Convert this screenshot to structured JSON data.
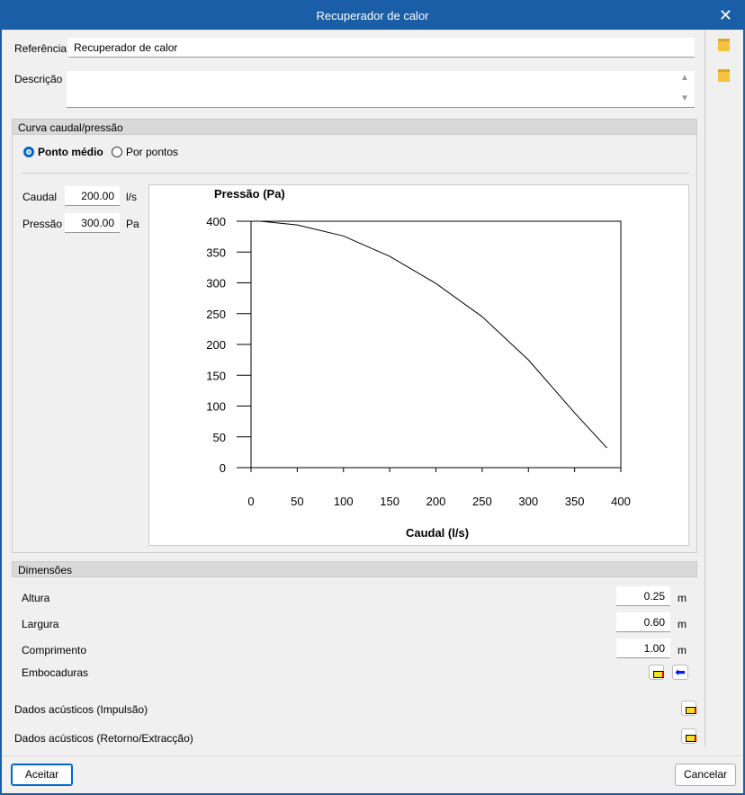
{
  "window": {
    "title": "Recuperador de calor"
  },
  "referencia": {
    "label": "Referência",
    "value": "Recuperador de calor"
  },
  "descricao": {
    "label": "Descrição",
    "value": ""
  },
  "curva": {
    "title": "Curva caudal/pressão",
    "options": [
      "Ponto médio",
      "Por pontos"
    ],
    "selected": "Ponto médio",
    "caudal": {
      "label": "Caudal",
      "value": "200.00",
      "unit": "l/s"
    },
    "pressao": {
      "label": "Pressão",
      "value": "300.00",
      "unit": "Pa"
    }
  },
  "chart_data": {
    "type": "line",
    "ylabel": "Pressão (Pa)",
    "xlabel": "Caudal (l/s)",
    "xlim": [
      0,
      400
    ],
    "ylim": [
      0,
      400
    ],
    "xticks": [
      0,
      50,
      100,
      150,
      200,
      250,
      300,
      350,
      400
    ],
    "yticks": [
      0,
      50,
      100,
      150,
      200,
      250,
      300,
      350,
      400
    ],
    "x": [
      10,
      50,
      100,
      150,
      200,
      250,
      300,
      350,
      385
    ],
    "y": [
      400,
      394,
      376,
      343,
      299,
      245,
      175,
      89,
      32
    ]
  },
  "dimensoes": {
    "title": "Dimensões",
    "rows": [
      {
        "label": "Altura",
        "value": "0.25",
        "unit": "m"
      },
      {
        "label": "Largura",
        "value": "0.60",
        "unit": "m"
      },
      {
        "label": "Comprimento",
        "value": "1.00",
        "unit": "m"
      }
    ],
    "embocaduras": "Embocaduras"
  },
  "acustico": {
    "impulsao": "Dados acústicos (Impulsão)",
    "retorno": "Dados acústicos (Retorno/Extracção)"
  },
  "buttons": {
    "accept": "Aceitar",
    "cancel": "Cancelar"
  },
  "colors": {
    "titlebar": "#1a5ea8",
    "accent": "#0066cc"
  }
}
